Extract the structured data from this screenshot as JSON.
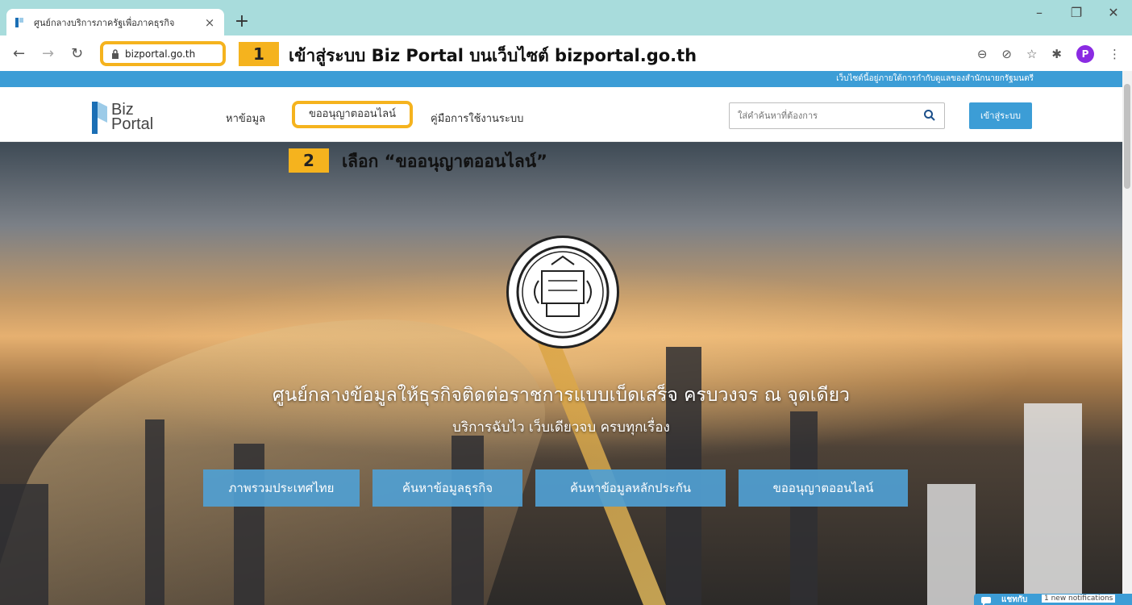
{
  "browser": {
    "tab_title": "ศูนย์กลางบริการภาครัฐเพื่อภาคธุรกิจ",
    "url": "bizportal.go.th",
    "profile_initial": "P"
  },
  "steps": {
    "step1_number": "1",
    "step1_text": "เข้าสู่ระบบ Biz Portal บนเว็บไซต์ bizportal.go.th",
    "step2_number": "2",
    "step2_text": "เลือก “ขออนุญาตออนไลน์”"
  },
  "site": {
    "gov_notice": "เว็บไซต์นี้อยู่ภายใต้การกำกับดูแลของสำนักนายกรัฐมนตรี",
    "logo_line1": "Biz",
    "logo_line2": "Portal",
    "menu": {
      "find": "หาข้อมูล",
      "permit": "ขออนุญาตออนไลน์",
      "manual": "คู่มือการใช้งานระบบ"
    },
    "search_placeholder": "ใส่คำค้นหาที่ต้องการ",
    "login_label": "เข้าสู่ระบบ"
  },
  "hero": {
    "title": "ศูนย์กลางข้อมูลให้ธุรกิจติดต่อราชการแบบเบ็ดเสร็จ ครบวงจร ณ จุดเดียว",
    "subtitle": "บริการฉับไว เว็บเดียวจบ ครบทุกเรื่อง",
    "buttons": {
      "b1": "ภาพรวมประเทศไทย",
      "b2": "ค้นหาข้อมูลธุรกิจ",
      "b3": "ค้นหาข้อมูลหลักประกัน",
      "b4": "ขออนุญาตออนไลน์"
    }
  },
  "chat": {
    "label": "แชทกับ",
    "notifications": "1 new notifications"
  },
  "colors": {
    "highlight": "#f5b31e",
    "brand_blue": "#3c9dd6",
    "chrome_frame": "#a8dcdc"
  }
}
